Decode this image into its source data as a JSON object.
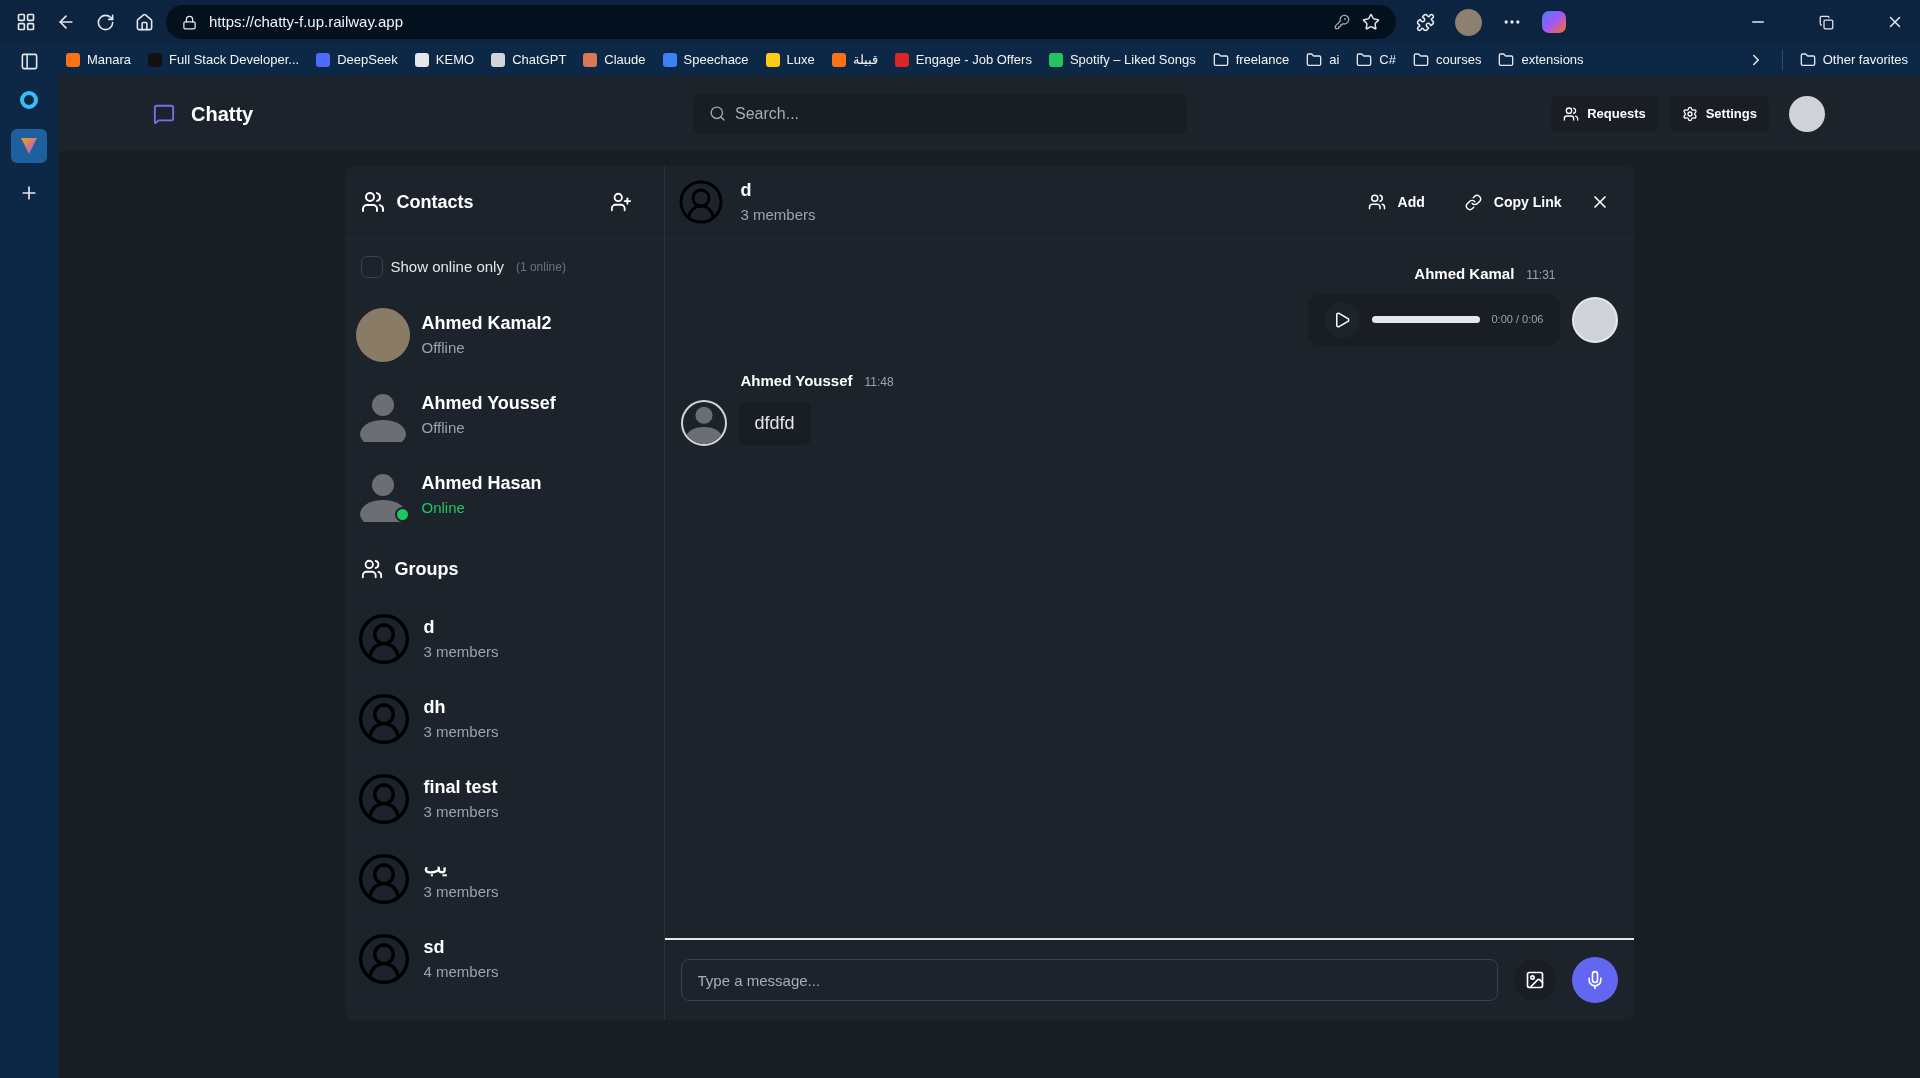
{
  "browser": {
    "url": "https://chatty-f.up.railway.app",
    "bookmarks": [
      {
        "label": "Manara",
        "kind": "site",
        "color": "#f97316"
      },
      {
        "label": "Full Stack Developer...",
        "kind": "site",
        "color": "#111111"
      },
      {
        "label": "DeepSeek",
        "kind": "site",
        "color": "#4d6bfe"
      },
      {
        "label": "KEMO",
        "kind": "site",
        "color": "#e5e7eb"
      },
      {
        "label": "ChatGPT",
        "kind": "site",
        "color": "#d1d5db"
      },
      {
        "label": "Claude",
        "kind": "site",
        "color": "#d97757"
      },
      {
        "label": "Speechace",
        "kind": "site",
        "color": "#3b82f6"
      },
      {
        "label": "Luxe",
        "kind": "site",
        "color": "#facc15"
      },
      {
        "label": "قبيلة",
        "kind": "site",
        "color": "#f97316"
      },
      {
        "label": "Engage - Job Offers",
        "kind": "site",
        "color": "#dc2626"
      },
      {
        "label": "Spotify – Liked Songs",
        "kind": "site",
        "color": "#22c55e"
      },
      {
        "label": "freelance",
        "kind": "folder"
      },
      {
        "label": "ai",
        "kind": "folder"
      },
      {
        "label": "C#",
        "kind": "folder"
      },
      {
        "label": "courses",
        "kind": "folder"
      },
      {
        "label": "extensions",
        "kind": "folder"
      }
    ],
    "other_favorites": "Other favorites"
  },
  "app": {
    "brand": "Chatty",
    "search": {
      "placeholder": "Search..."
    },
    "header_buttons": [
      {
        "label": "Requests",
        "kind": "requests"
      },
      {
        "label": "Settings",
        "kind": "settings"
      }
    ]
  },
  "contacts": {
    "title": "Contacts",
    "filter": {
      "label": "Show online only",
      "count": "(1 online)",
      "checked": false
    },
    "items": [
      {
        "name": "Ahmed Kamal2",
        "status": "Offline",
        "online": false,
        "kind": "photo"
      },
      {
        "name": "Ahmed Youssef",
        "status": "Offline",
        "online": false,
        "kind": "default"
      },
      {
        "name": "Ahmed Hasan",
        "status": "Online",
        "online": true,
        "kind": "default"
      }
    ]
  },
  "groups": {
    "title": "Groups",
    "items": [
      {
        "name": "d",
        "members": "3 members"
      },
      {
        "name": "dh",
        "members": "3 members"
      },
      {
        "name": "final test",
        "members": "3 members"
      },
      {
        "name": "يب",
        "members": "3 members"
      },
      {
        "name": "sd",
        "members": "4 members"
      }
    ]
  },
  "chat": {
    "name": "d",
    "members": "3 members",
    "actions": [
      {
        "label": "Add",
        "kind": "add"
      },
      {
        "label": "Copy Link",
        "kind": "link"
      }
    ],
    "messages": [
      {
        "kind": "audio",
        "own": true,
        "sender": "Ahmed Kamal",
        "time": "11:31",
        "duration": "0:00 / 0:06"
      },
      {
        "kind": "text",
        "own": false,
        "sender": "Ahmed Youssef",
        "time": "11:48",
        "text": "dfdfd"
      }
    ],
    "composer": {
      "placeholder": "Type a message..."
    }
  }
}
